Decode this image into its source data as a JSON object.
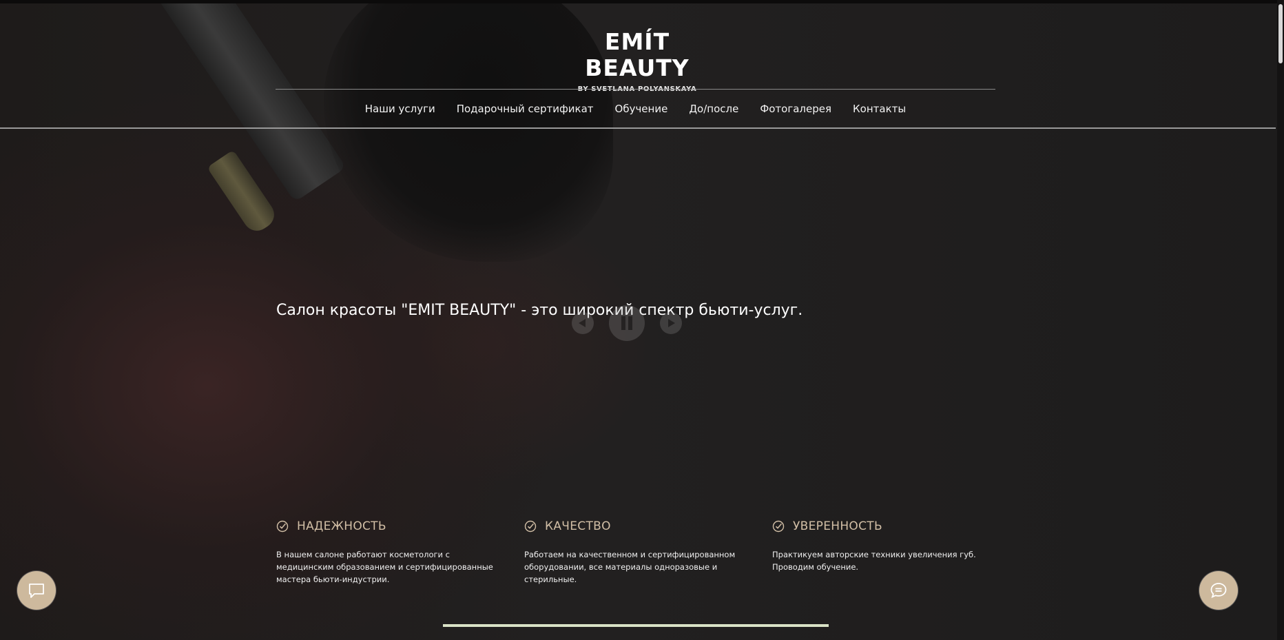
{
  "header": {
    "logo_title": "EMÍT BEAUTY",
    "logo_subtitle": "BY SVETLANA POLYANSKAYA"
  },
  "nav": {
    "items": [
      {
        "label": "Наши услуги"
      },
      {
        "label": "Подарочный сертификат"
      },
      {
        "label": "Обучение"
      },
      {
        "label": "До/после"
      },
      {
        "label": "Фотогалерея"
      },
      {
        "label": "Контакты"
      }
    ]
  },
  "hero": {
    "tagline": "Салон красоты \"EMIT BEAUTY\" - это широкий спектр бьюти-услуг."
  },
  "features": [
    {
      "title": "НАДЕЖНОСТЬ",
      "text": "В нашем салоне работают косметологи с медицинским образованием и сертифицированные мастера бьюти-индустрии."
    },
    {
      "title": "КАЧЕСТВО",
      "text": "Работаем на качественном и сертифицированном оборудовании, все материалы одноразовые и стерильные."
    },
    {
      "title": "УВЕРЕННОСТЬ",
      "text": "Практикуем авторские техники увеличения губ. Проводим обучение."
    }
  ],
  "colors": {
    "accent": "#d2bfa6",
    "chat_button": "#cdb99d",
    "progress": "#d9e2c6",
    "background": "#1b1918"
  },
  "icons": {
    "feature": "check-circle-icon",
    "chat_left": "chat-bubble-icon",
    "chat_right": "message-icon"
  }
}
